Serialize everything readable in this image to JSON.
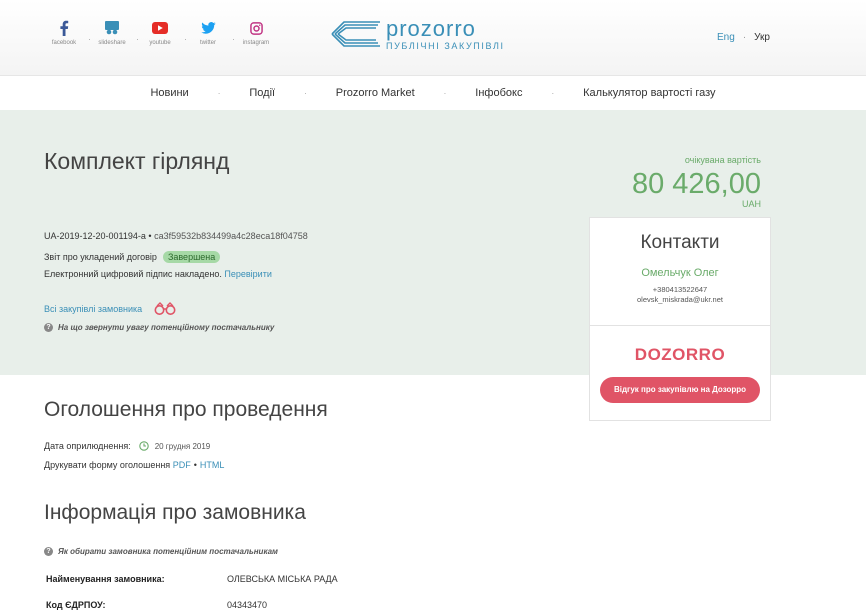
{
  "socials": [
    {
      "icon": "facebook-icon",
      "label": "facebook"
    },
    {
      "icon": "slideshare-icon",
      "label": "slideshare"
    },
    {
      "icon": "youtube-icon",
      "label": "youtube"
    },
    {
      "icon": "twitter-icon",
      "label": "twitter"
    },
    {
      "icon": "instagram-icon",
      "label": "instagram"
    }
  ],
  "logo": {
    "name": "prozorro",
    "subtitle": "ПУБЛІЧНІ ЗАКУПІВЛІ"
  },
  "lang": {
    "eng": "Eng",
    "sep": "·",
    "ukr": "Укр"
  },
  "nav": {
    "separator": "·",
    "items": [
      "Новини",
      "Події",
      "Prozorro Market",
      "Інфобокс",
      "Калькулятор вартості газу"
    ]
  },
  "tender": {
    "title": "Комплект гірлянд",
    "id": "UA-2019-12-20-001194-a",
    "id_sep": "•",
    "hash": "ca3f59532b834499a4c28eca18f04758",
    "report_label": "Звіт про укладений договір",
    "status": "Завершена",
    "signature_text": "Електронний цифровий підпис накладено.",
    "signature_link": "Перевірити",
    "all_purchases_link": "Всі закупівлі замовника",
    "hint": "На що звернути увагу потенційному постачальнику"
  },
  "price": {
    "label": "очікувана вартість",
    "value": "80 426,00",
    "currency": "UAH"
  },
  "contacts": {
    "title": "Контакти",
    "name": "Омельчук Олег",
    "phone": "+380413522647",
    "email": "olevsk_miskrada@ukr.net"
  },
  "dozorro": {
    "logo": "DOZORRO",
    "button": "Відгук про закупівлю на Дозорро"
  },
  "announcement": {
    "title": "Оголошення про проведення",
    "date_label": "Дата оприлюднення:",
    "date_value": "20 грудня 2019",
    "print_label": "Друкувати форму оголошення",
    "pdf": "PDF",
    "sep": "•",
    "html": "HTML"
  },
  "customer": {
    "title": "Інформація про замовника",
    "hint": "Як обирати замовника потенційним постачальникам",
    "rows": [
      {
        "label": "Найменування замовника:",
        "value": "ОЛЕВСЬКА МІСЬКА РАДА"
      },
      {
        "label": "Код ЄДРПОУ:",
        "value": "04343470"
      }
    ]
  },
  "colors": {
    "accent": "#3a8fb7",
    "green": "#6aab6a",
    "dozorro": "#e05466",
    "hero_bg": "#e8efea"
  }
}
